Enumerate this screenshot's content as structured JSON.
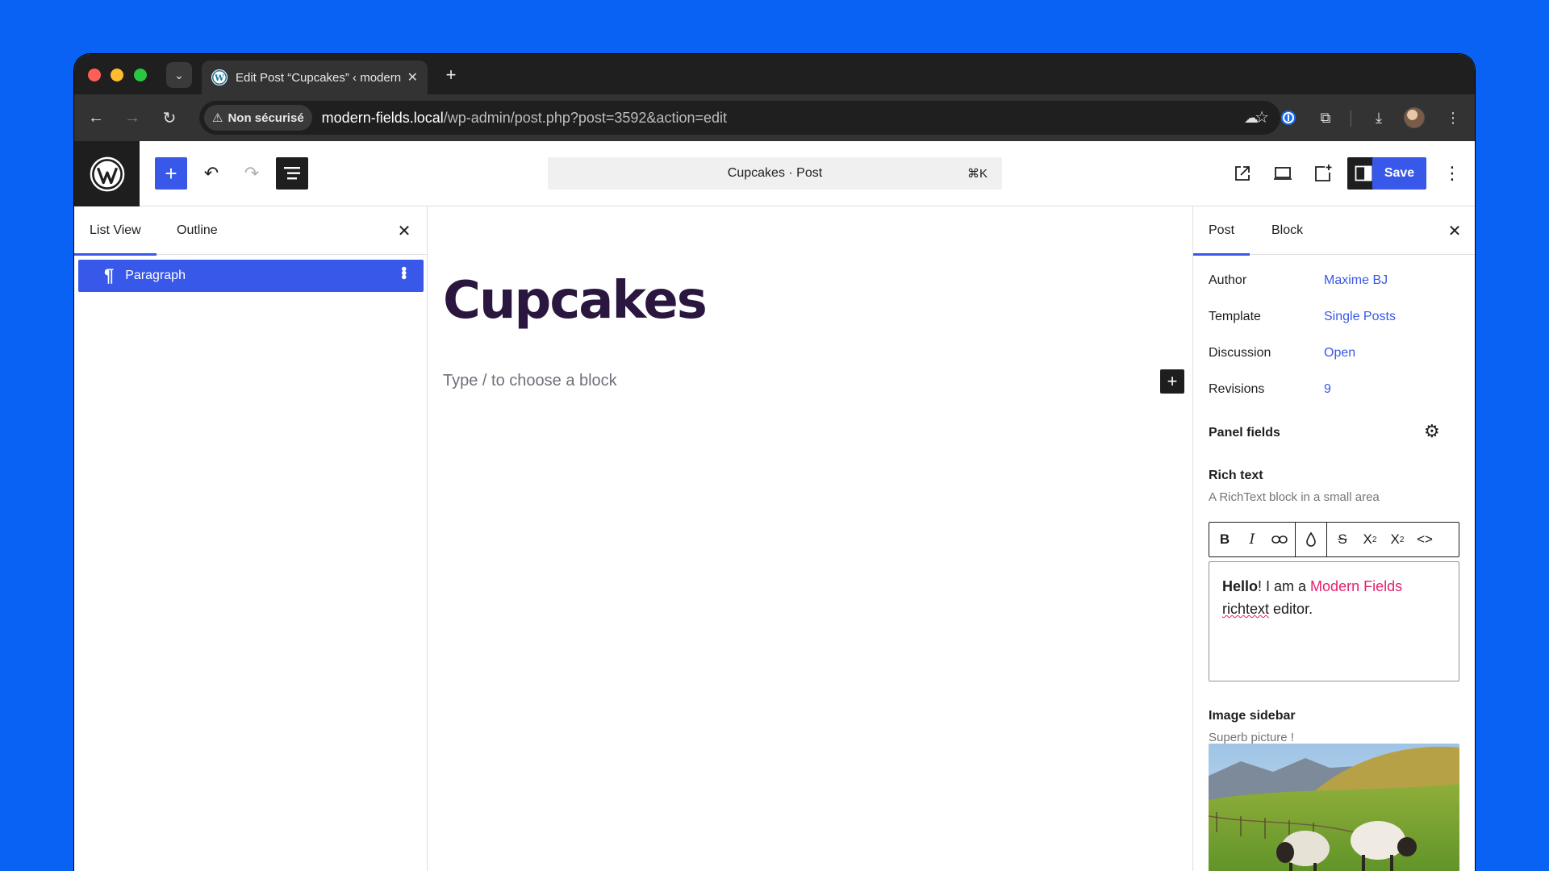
{
  "browser": {
    "tab_title": "Edit Post “Cupcakes” ‹ modern-fields.local",
    "security_label": "Non sécurisé",
    "url_host": "modern-fields.local",
    "url_path": "/wp-admin/post.php?post=3592&action=edit"
  },
  "wp_header": {
    "command_title": "Cupcakes · Post",
    "command_shortcut": "⌘K",
    "save_label": "Save"
  },
  "left_panel": {
    "tabs": [
      {
        "label": "List View"
      },
      {
        "label": "Outline"
      }
    ],
    "items": [
      {
        "label": "Paragraph"
      }
    ]
  },
  "canvas": {
    "post_title": "Cupcakes",
    "block_placeholder": "Type / to choose a block"
  },
  "right_panel": {
    "tabs": [
      {
        "label": "Post"
      },
      {
        "label": "Block"
      }
    ],
    "meta": [
      {
        "label": "Author",
        "value": "Maxime BJ"
      },
      {
        "label": "Template",
        "value": "Single Posts"
      },
      {
        "label": "Discussion",
        "value": "Open"
      },
      {
        "label": "Revisions",
        "value": "9"
      }
    ],
    "panel_title": "Panel fields",
    "rich_text": {
      "label": "Rich text",
      "help": "A RichText block in a small area",
      "content_bold": "Hello",
      "content_1": "! I am a ",
      "content_link": "Modern Fields",
      "content_spell": "richtext",
      "content_2": " editor."
    },
    "image_field": {
      "label": "Image sidebar",
      "help": "Superb picture !"
    }
  },
  "colors": {
    "background": "#0a62f5",
    "wp_accent": "#3858e9",
    "title_color": "#2a163f",
    "link_pink": "#e5206e"
  }
}
